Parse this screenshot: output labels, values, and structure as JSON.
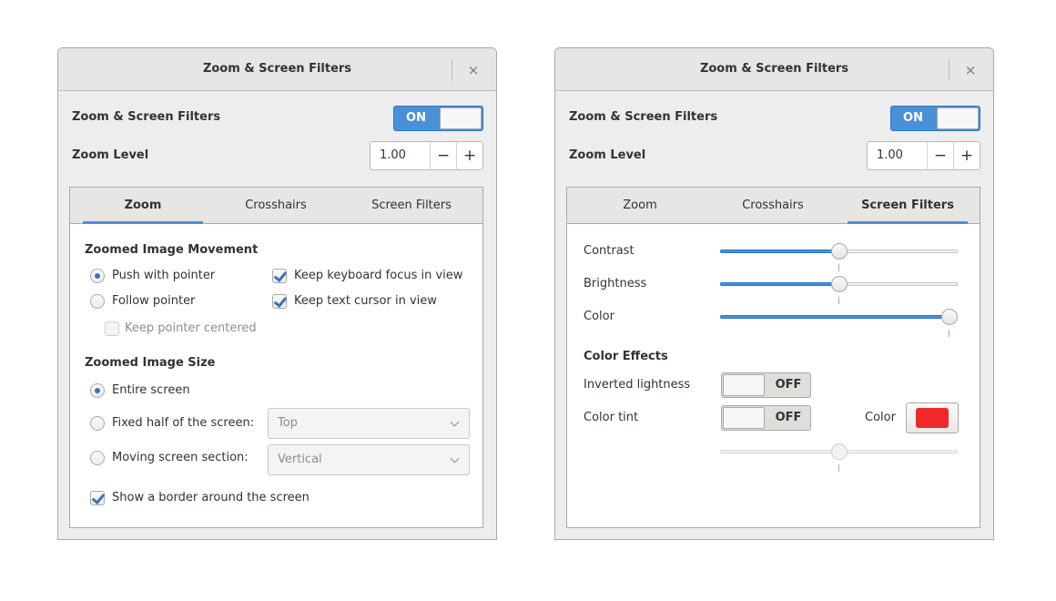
{
  "dialogs": [
    {
      "title": "Zoom & Screen Filters",
      "enable_label": "Zoom & Screen Filters",
      "enable_state": "ON",
      "zoom_level_label": "Zoom Level",
      "zoom_level_value": "1.00",
      "minus": "−",
      "plus": "+",
      "close": "×",
      "tabs": [
        "Zoom",
        "Crosshairs",
        "Screen Filters"
      ],
      "active_tab": "Zoom"
    },
    {
      "title": "Zoom & Screen Filters",
      "enable_label": "Zoom & Screen Filters",
      "enable_state": "ON",
      "zoom_level_label": "Zoom Level",
      "zoom_level_value": "1.00",
      "minus": "−",
      "plus": "+",
      "close": "×",
      "tabs": [
        "Zoom",
        "Crosshairs",
        "Screen Filters"
      ],
      "active_tab": "Screen Filters"
    }
  ],
  "zoom_tab": {
    "movement_heading": "Zoomed Image Movement",
    "push_with_pointer": "Push with pointer",
    "follow_pointer": "Follow pointer",
    "keep_pointer_centered": "Keep pointer centered",
    "keep_keyboard_focus": "Keep keyboard focus in view",
    "keep_text_cursor": "Keep text cursor in view",
    "size_heading": "Zoomed Image Size",
    "entire_screen": "Entire screen",
    "fixed_half": "Fixed half of the screen:",
    "fixed_half_value": "Top",
    "moving_section": "Moving screen section:",
    "moving_section_value": "Vertical",
    "show_border": "Show a border around the screen"
  },
  "filters_tab": {
    "contrast_label": "Contrast",
    "contrast_value": 0.5,
    "brightness_label": "Brightness",
    "brightness_value": 0.5,
    "color_label": "Color",
    "color_value": 1.0,
    "effects_heading": "Color Effects",
    "inverted_label": "Inverted lightness",
    "inverted_state": "OFF",
    "tint_label": "Color tint",
    "tint_state": "OFF",
    "tint_color_label": "Color",
    "tint_color": "#ef2929",
    "tint_slider_value": 0.5
  },
  "colors": {
    "accent": "#4a90d9",
    "window_bg": "#ededed",
    "tint_swatch": "#ef2929"
  }
}
